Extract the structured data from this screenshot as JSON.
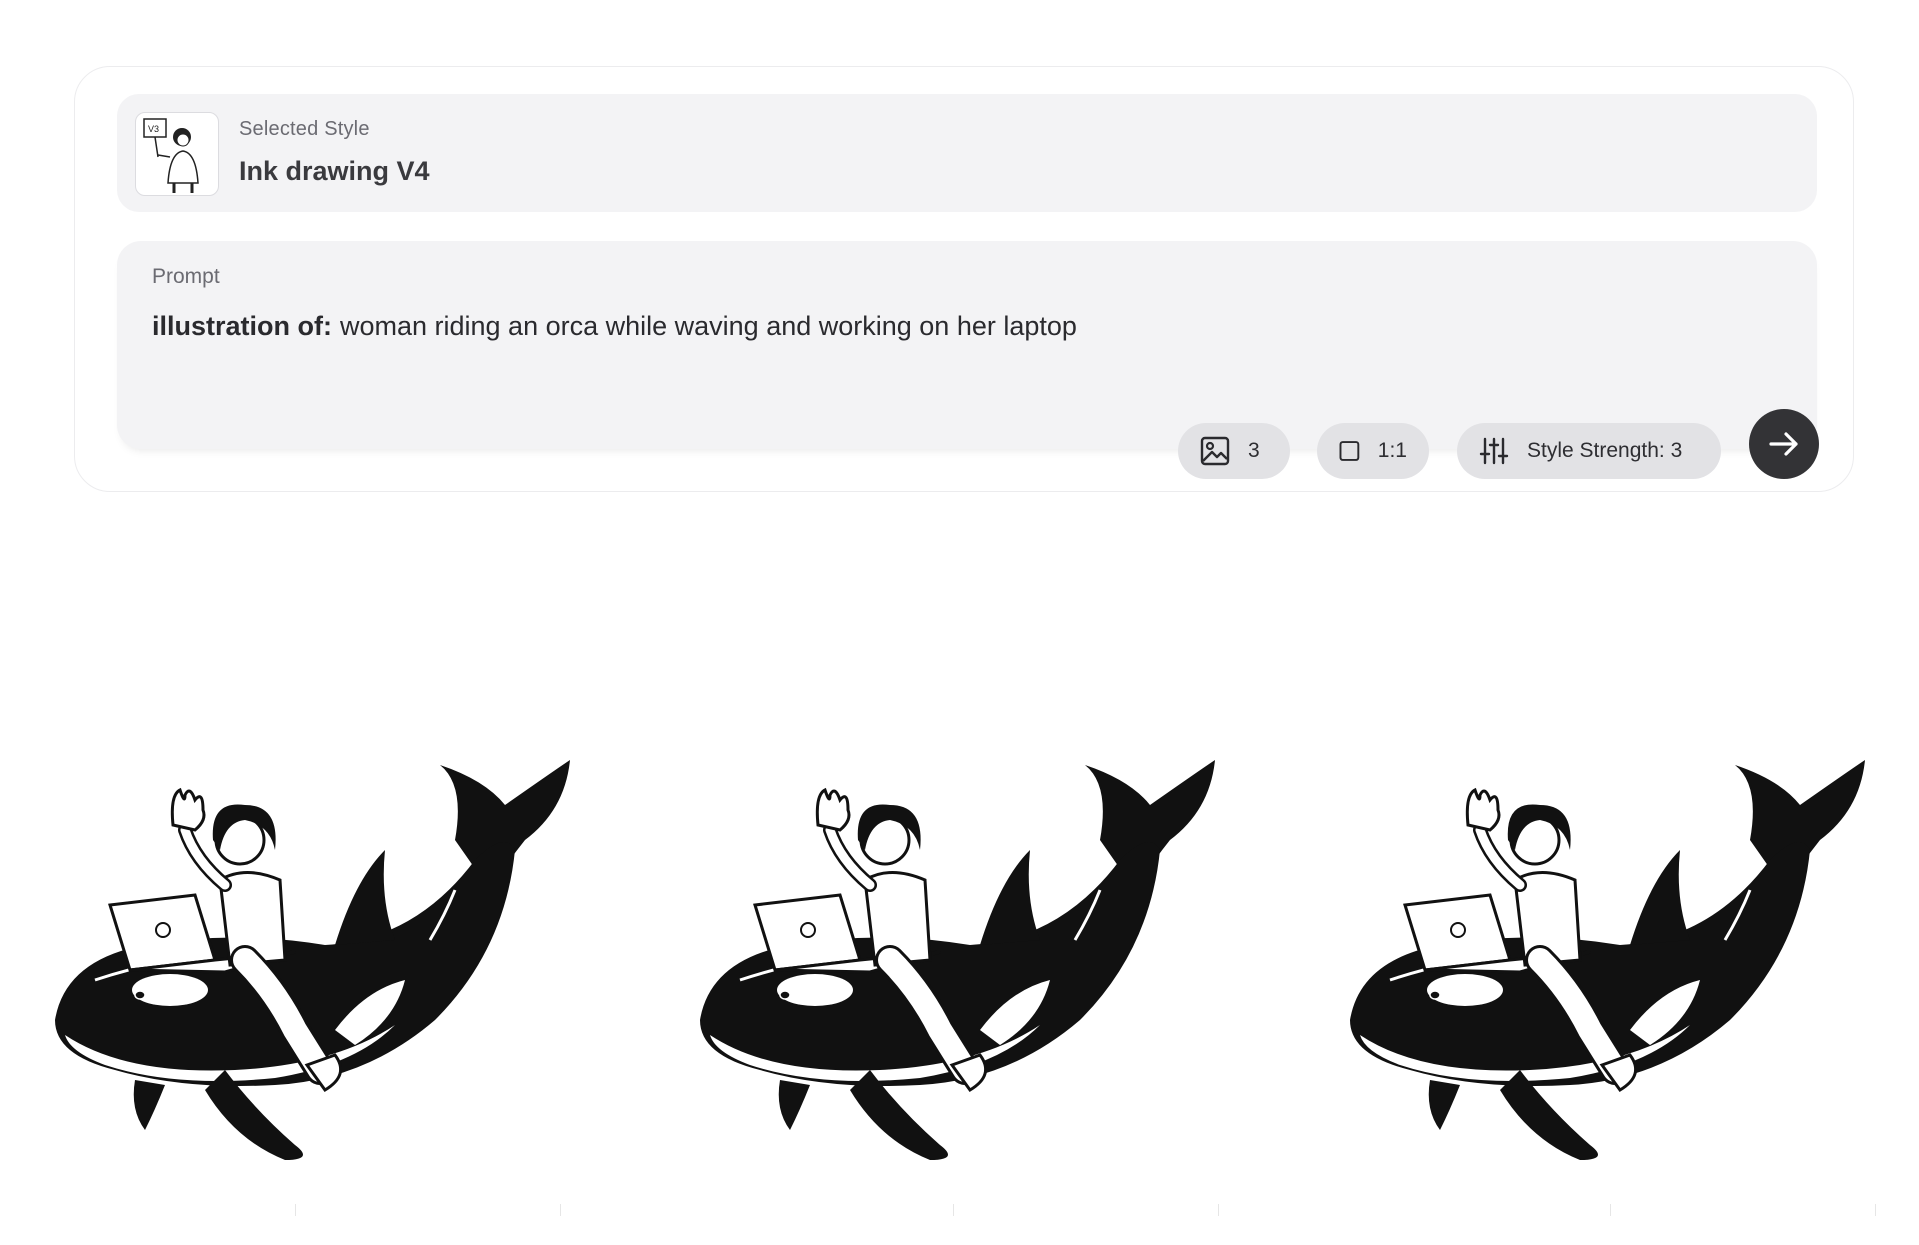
{
  "selected_style": {
    "caption": "Selected Style",
    "name": "Ink drawing V4",
    "thumbnail_icon": "ink-drawing-style-thumbnail",
    "thumbnail_badge": "V3"
  },
  "prompt": {
    "caption": "Prompt",
    "prefix": "illustration of:",
    "text": "woman riding an orca while waving and working on her laptop"
  },
  "controls": {
    "image_count": {
      "icon": "image-icon",
      "value": "3"
    },
    "aspect_ratio": {
      "icon": "square-icon",
      "value": "1:1"
    },
    "style_strength": {
      "icon": "sliders-icon",
      "label": "Style Strength: 3"
    },
    "submit": {
      "icon": "arrow-right-icon"
    }
  },
  "results": [
    {
      "name": "generated-image-1",
      "subject": "woman riding an orca while waving and working on her laptop"
    },
    {
      "name": "generated-image-2",
      "subject": "woman riding an orca while waving and working on her laptop"
    },
    {
      "name": "generated-image-3",
      "subject": "woman riding an orca while waving and working on her laptop"
    }
  ],
  "colors": {
    "panel_bg": "#f3f3f5",
    "pill_bg": "#e2e2e5",
    "submit_bg": "#333336",
    "ink": "#111111"
  }
}
